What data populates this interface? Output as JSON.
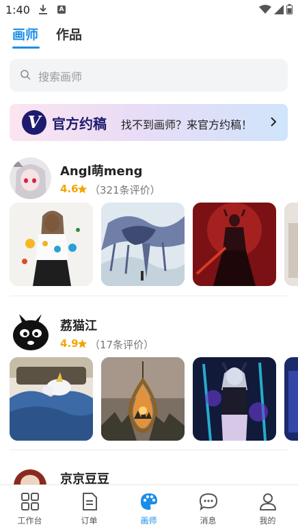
{
  "status_bar": {
    "time": "1:40",
    "a_badge": "A"
  },
  "top_tabs": [
    {
      "label": "画师",
      "active": true
    },
    {
      "label": "作品",
      "active": false
    }
  ],
  "search": {
    "placeholder": "搜索画师"
  },
  "banner": {
    "logo_letter": "V",
    "brand": "官方约稿",
    "text": "找不到画师？来官方约稿！"
  },
  "artists": [
    {
      "name": "Angl萌meng",
      "rating": "4.6",
      "reviews": "（321条评价）"
    },
    {
      "name": "荔猫江",
      "rating": "4.9",
      "reviews": "（17条评价）"
    },
    {
      "name": "京京豆豆",
      "rating": "",
      "reviews": ""
    }
  ],
  "bottom_nav": [
    {
      "label": "工作台",
      "icon": "grid-icon",
      "active": false
    },
    {
      "label": "订单",
      "icon": "document-icon",
      "active": false
    },
    {
      "label": "画师",
      "icon": "palette-icon",
      "active": true
    },
    {
      "label": "消息",
      "icon": "chat-icon",
      "active": false
    },
    {
      "label": "我的",
      "icon": "person-icon",
      "active": false
    }
  ],
  "colors": {
    "accent": "#1a8de9",
    "rating": "#f2a500",
    "brand": "#1e1a6e"
  }
}
